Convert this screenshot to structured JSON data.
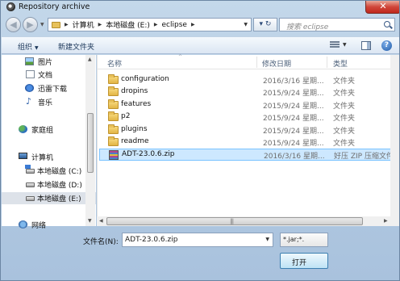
{
  "window": {
    "title": "Repository archive",
    "close_label": "✕"
  },
  "nav": {
    "back_icon": "back-arrow-icon",
    "forward_icon": "forward-arrow-icon",
    "breadcrumb": [
      "计算机",
      "本地磁盘 (E:)",
      "eclipse"
    ],
    "refresh_label": "▾ ↻",
    "search_placeholder": "搜索 eclipse"
  },
  "toolbar": {
    "organize": "组织",
    "new_folder": "新建文件夹",
    "help": "?"
  },
  "sidebar": {
    "items": [
      {
        "label": "图片",
        "icon": "pictures-icon"
      },
      {
        "label": "文档",
        "icon": "documents-icon"
      },
      {
        "label": "迅雷下载",
        "icon": "thunder-download-icon"
      },
      {
        "label": "音乐",
        "icon": "music-icon"
      },
      {
        "label": "家庭组",
        "icon": "homegroup-icon"
      },
      {
        "label": "计算机",
        "icon": "computer-icon"
      },
      {
        "label": "本地磁盘 (C:)",
        "icon": "drive-icon"
      },
      {
        "label": "本地磁盘 (D:)",
        "icon": "drive-icon"
      },
      {
        "label": "本地磁盘 (E:)",
        "icon": "drive-icon"
      },
      {
        "label": "网络",
        "icon": "network-icon"
      }
    ]
  },
  "filelist": {
    "columns": [
      "名称",
      "修改日期",
      "类型"
    ],
    "rows": [
      {
        "name": "configuration",
        "date": "2016/3/16 星期...",
        "type": "文件夹",
        "kind": "folder"
      },
      {
        "name": "dropins",
        "date": "2015/9/24 星期...",
        "type": "文件夹",
        "kind": "folder"
      },
      {
        "name": "features",
        "date": "2015/9/24 星期...",
        "type": "文件夹",
        "kind": "folder"
      },
      {
        "name": "p2",
        "date": "2015/9/24 星期...",
        "type": "文件夹",
        "kind": "folder"
      },
      {
        "name": "plugins",
        "date": "2015/9/24 星期...",
        "type": "文件夹",
        "kind": "folder"
      },
      {
        "name": "readme",
        "date": "2015/9/24 星期...",
        "type": "文件夹",
        "kind": "folder"
      },
      {
        "name": "ADT-23.0.6.zip",
        "date": "2016/3/16 星期...",
        "type": "好压 ZIP 压缩文件",
        "kind": "zip"
      }
    ],
    "selected_row": 6
  },
  "footer": {
    "filename_label": "文件名(N):",
    "filename_value": "ADT-23.0.6.zip",
    "filter_value": "*.jar;*.",
    "open_label": "打开"
  }
}
